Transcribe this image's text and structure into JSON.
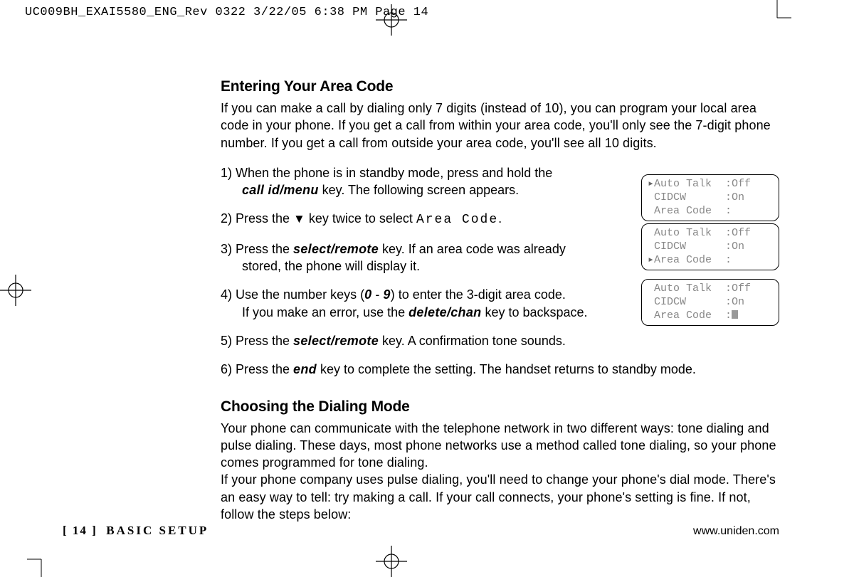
{
  "slug": "UC009BH_EXAI5580_ENG_Rev 0322  3/22/05  6:38 PM  Page 14",
  "heading1": "Entering Your Area Code",
  "intro1": "If you can make a call by dialing only 7 digits (instead of 10), you can program your local area code in your phone. If you get a call from within your area code, you'll only see the 7-digit phone number. If you get a call from outside your area code, you'll see all 10 digits.",
  "steps": {
    "s1a": "1) When the phone is in standby mode, press and hold the",
    "s1b_key": "call id/menu",
    "s1c": " key. The following screen appears.",
    "s2a": "2) Press the ",
    "s2_arrow": "▼",
    "s2b": " key twice to select ",
    "s2_mono": "Area Code",
    "s2c": ".",
    "s3a": "3) Press the ",
    "s3_key": "select/remote",
    "s3b": " key. If an area code was already",
    "s3c": "stored, the phone will display it.",
    "s4a": "4) Use the number keys (",
    "s4_key1": "0",
    "s4b": " - ",
    "s4_key2": "9",
    "s4c": ") to enter the 3-digit area code.",
    "s4d": "If you make an error, use the ",
    "s4_key3": "delete/chan",
    "s4e": " key to backspace.",
    "s5a": "5) Press the ",
    "s5_key": "select/remote",
    "s5b": " key. A confirmation tone sounds.",
    "s6a": "6) Press the ",
    "s6_key": "end",
    "s6b": " key to complete the setting. The handset returns to standby mode."
  },
  "heading2": "Choosing the Dialing Mode",
  "intro2": "Your phone can communicate with the telephone network in two different ways: tone dialing and pulse dialing. These days, most phone networks use a method called tone dialing, so your phone comes programmed for tone dialing.",
  "intro2b": "If your phone company uses pulse dialing, you'll need to change your phone's dial mode. There's an easy way to tell: try making a call. If your call connects, your phone's setting is fine. If not, follow the steps below:",
  "lcd1": {
    "r1l": "Auto Talk",
    "r1r": ":Off",
    "r2l": "CIDCW",
    "r2r": ":On",
    "r3l": "Area Code",
    "r3r": ":",
    "ptr_row": 0
  },
  "lcd2": {
    "r1l": "Auto Talk",
    "r1r": ":Off",
    "r2l": "CIDCW",
    "r2r": ":On",
    "r3l": "Area Code",
    "r3r": ":",
    "ptr_row": 2
  },
  "lcd3": {
    "r1l": "Auto Talk",
    "r1r": ":Off",
    "r2l": "CIDCW",
    "r2r": ":On",
    "r3l": "Area Code",
    "r3r": ":",
    "cursor": true
  },
  "footer": {
    "page": "[ 14 ]",
    "section": "BASIC SETUP",
    "url": "www.uniden.com"
  }
}
